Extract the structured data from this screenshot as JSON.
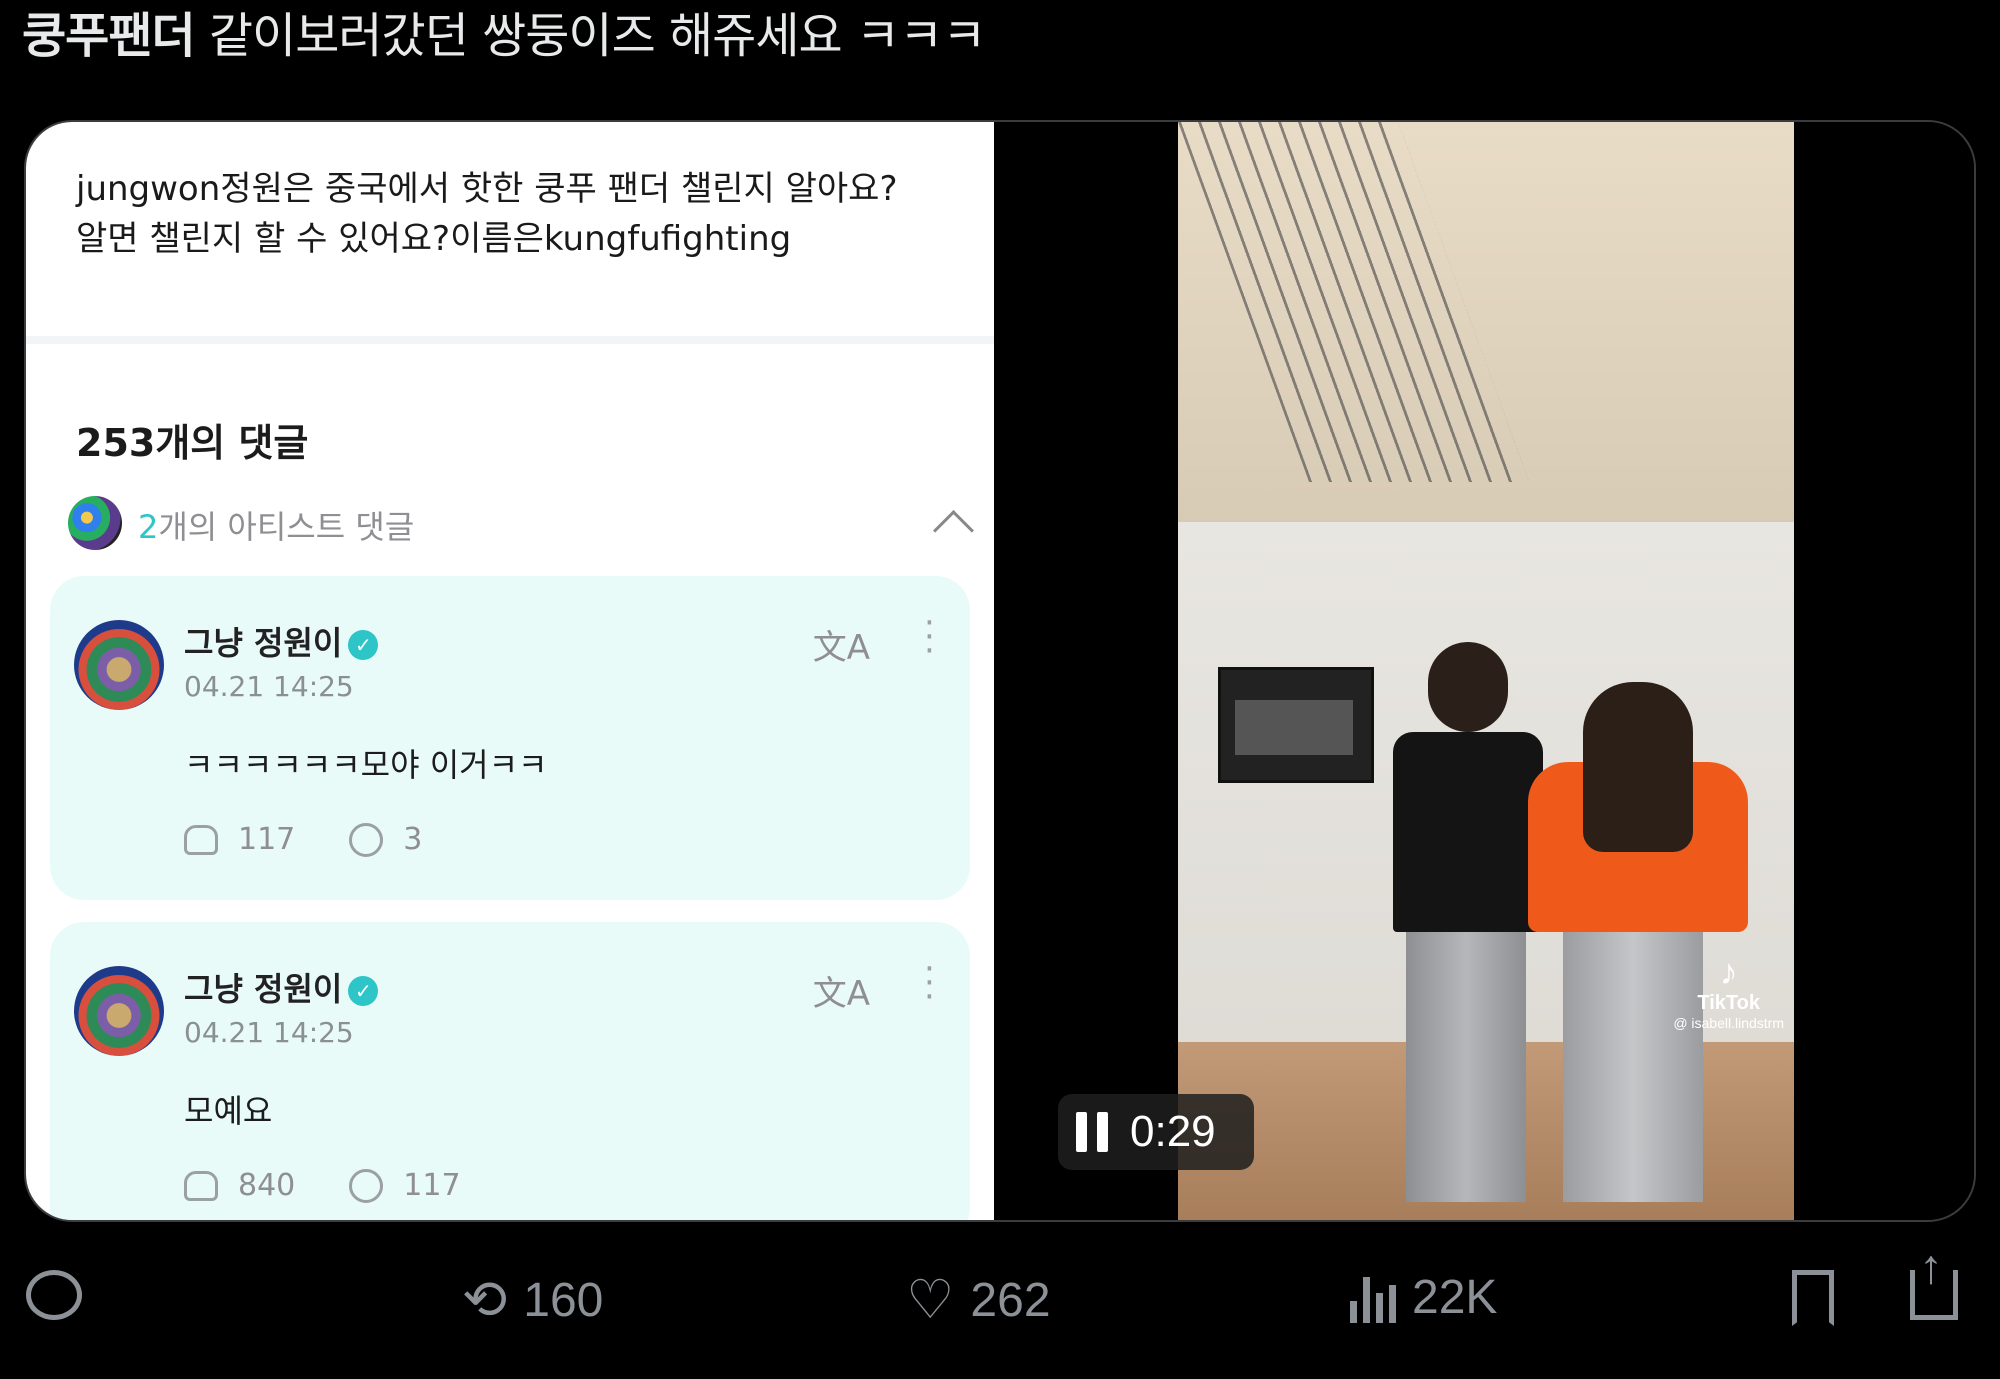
{
  "tweet": {
    "text_bold": "쿵푸팬더",
    "text_rest": " 같이보러갔던 쌍둥이즈 해쥬세요 ㅋㅋㅋ"
  },
  "post": {
    "line1": "jungwon정원은 중국에서 핫한 쿵푸 팬더 챌린지 알아요?",
    "line2": "알면 챌린지 할 수 있어요?이름은kungfufighting"
  },
  "comments": {
    "title": "253개의 댓글",
    "artist_count": "2",
    "artist_label": "개의 아티스트 댓글"
  },
  "cards": [
    {
      "name": "그냥 정원이",
      "date": "04.21 14:25",
      "comment": "ㅋㅋㅋㅋㅋㅋ모야 이거ㅋㅋ",
      "likes": "117",
      "replies": "3"
    },
    {
      "name": "그냥 정원이",
      "date": "04.21 14:25",
      "comment": "모예요",
      "likes": "840",
      "replies": "117"
    }
  ],
  "video": {
    "watermark_brand": "TikTok",
    "watermark_user": "@ isabell.lindstrm",
    "time": "0:29"
  },
  "actions": {
    "retweets": "160",
    "likes": "262",
    "views": "22K"
  },
  "icons": {
    "translate": "文A",
    "verified": "✓",
    "tiktok": "♪"
  }
}
